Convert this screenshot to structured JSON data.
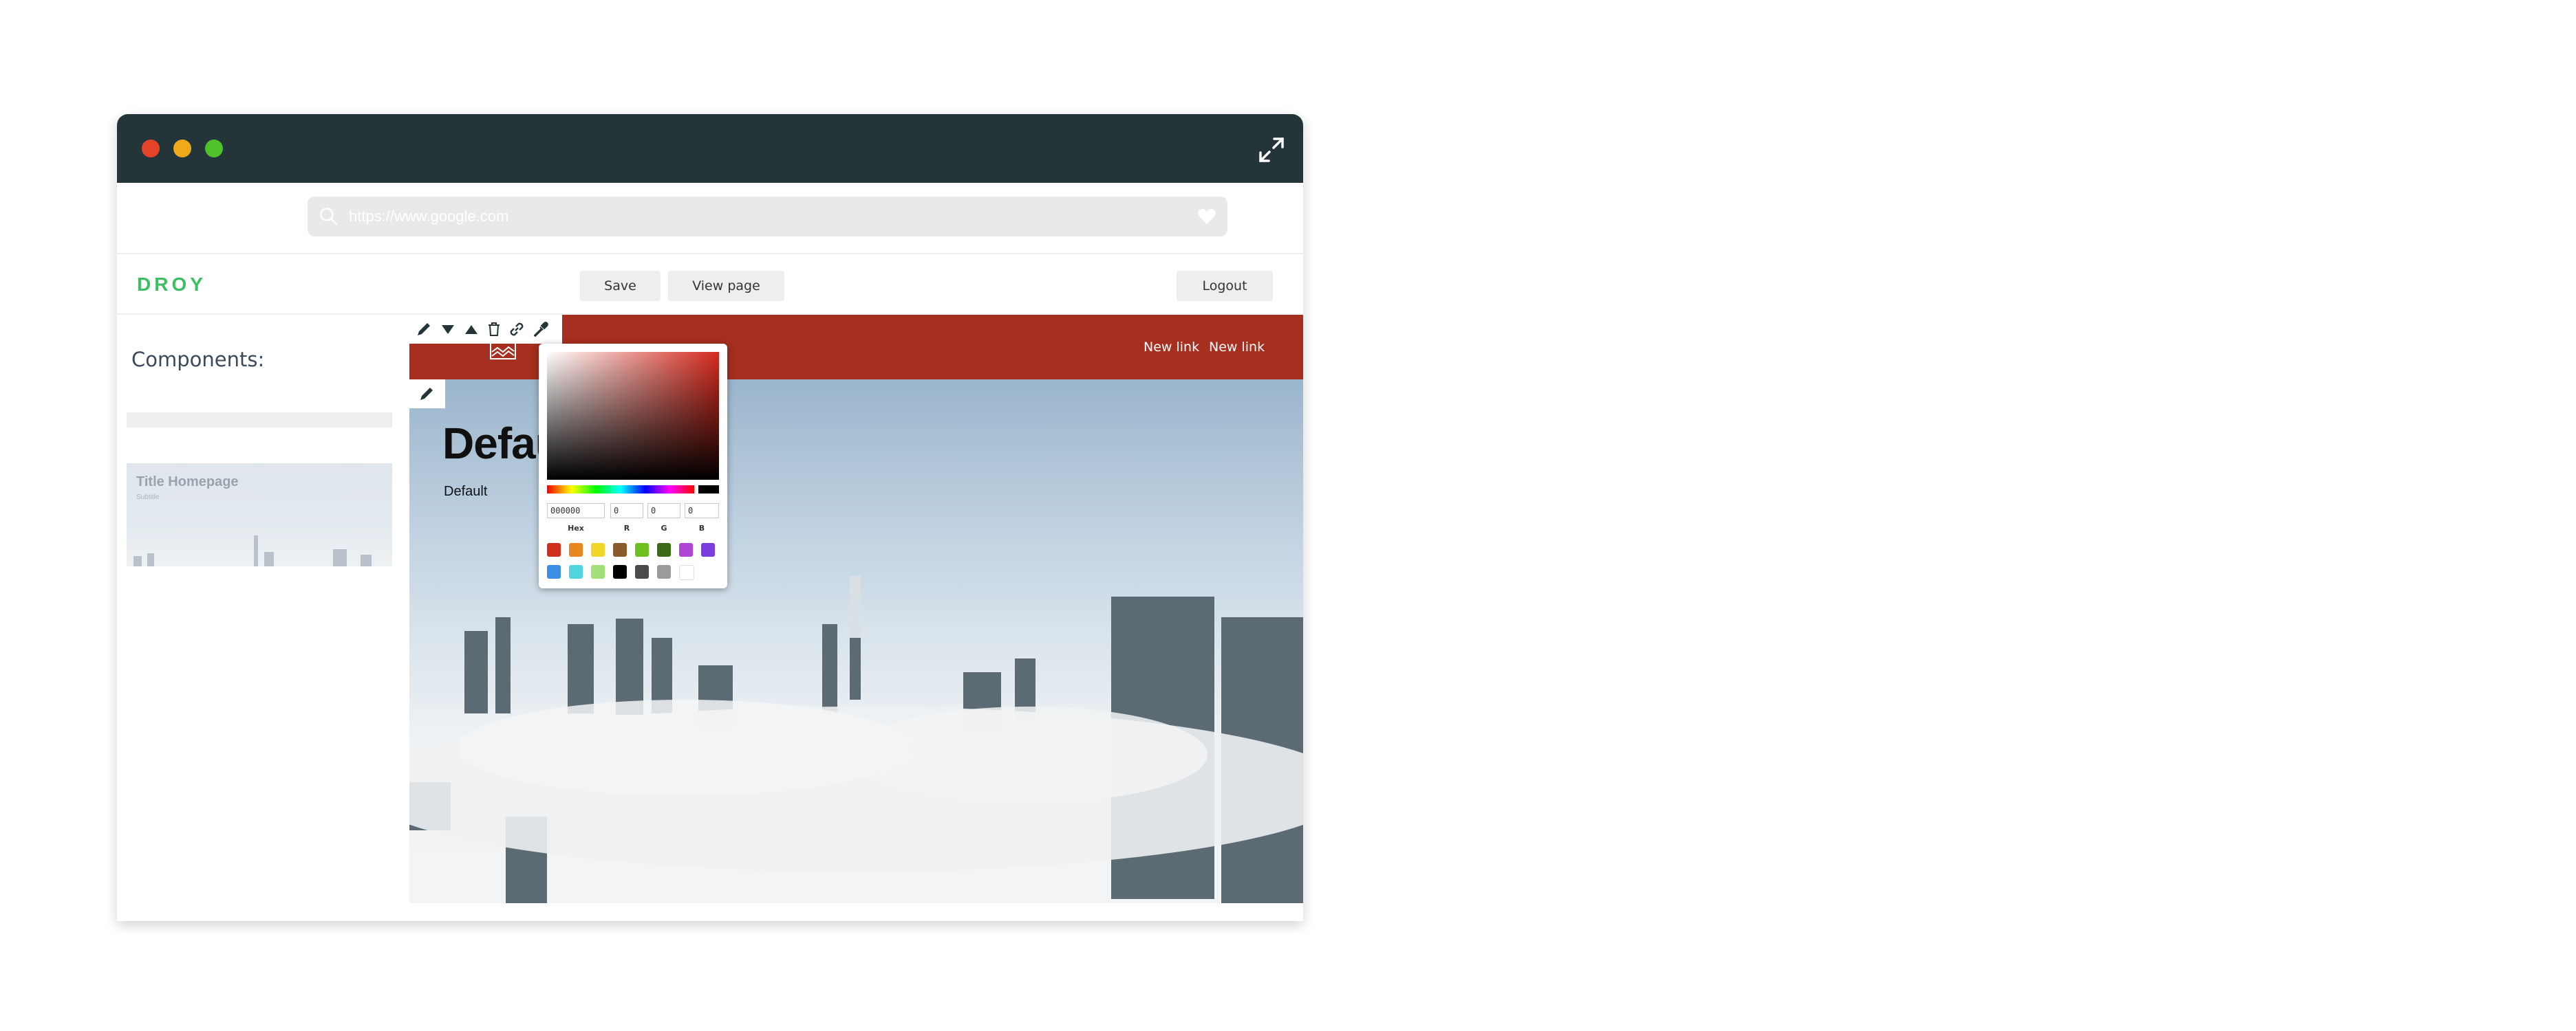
{
  "browser": {
    "url_placeholder": "https://www.google.com"
  },
  "app": {
    "logo": "DROY",
    "save_label": "Save",
    "view_page_label": "View page",
    "logout_label": "Logout"
  },
  "sidebar": {
    "title": "Components:",
    "thumbnail_title": "Title Homepage",
    "thumbnail_subtitle": "Subtitle"
  },
  "preview": {
    "nav_links": [
      "New link",
      "New link"
    ],
    "hero_title": "Default",
    "hero_subtitle": "Default"
  },
  "color_picker": {
    "hex": "000000",
    "r": "0",
    "g": "0",
    "b": "0",
    "labels": [
      "Hex",
      "R",
      "G",
      "B"
    ],
    "swatches_row1": [
      "#d0311f",
      "#e7871f",
      "#f1d52b",
      "#8a5a2b",
      "#6fbf1f",
      "#3b6b17",
      "#b046d4",
      "#7a3ee0"
    ],
    "swatches_row2": [
      "#3f8ee6",
      "#52d3e0",
      "#a4e07a",
      "#000000",
      "#4a4a4a",
      "#9b9b9b",
      "#ffffff"
    ]
  },
  "colors": {
    "titlebar": "#243539",
    "accent_green": "#3cbf62",
    "preview_bar": "#a62f1f"
  }
}
